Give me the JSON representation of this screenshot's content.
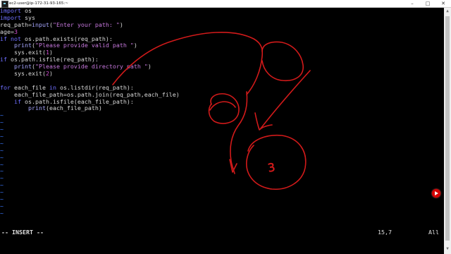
{
  "window": {
    "title": "ec2-user@ip-172-31-93-165:~",
    "minimize": "–",
    "maximize": "□",
    "close": "✕"
  },
  "editor": {
    "lines": [
      [
        {
          "t": "import",
          "c": "kw"
        },
        {
          "t": " os",
          "c": "plain"
        }
      ],
      [
        {
          "t": "import",
          "c": "kw"
        },
        {
          "t": " sys",
          "c": "plain"
        }
      ],
      [
        {
          "t": "req_path=",
          "c": "plain"
        },
        {
          "t": "input",
          "c": "fn"
        },
        {
          "t": "(",
          "c": "plain"
        },
        {
          "t": "\"Enter your path: \"",
          "c": "str"
        },
        {
          "t": ")",
          "c": "plain"
        }
      ],
      [
        {
          "t": "age=",
          "c": "plain"
        },
        {
          "t": "3",
          "c": "num"
        }
      ],
      [
        {
          "t": "if",
          "c": "kw"
        },
        {
          "t": " ",
          "c": "plain"
        },
        {
          "t": "not",
          "c": "kw"
        },
        {
          "t": " os.path.exists(req_path):",
          "c": "plain"
        }
      ],
      [
        {
          "t": "    ",
          "c": "plain"
        },
        {
          "t": "print",
          "c": "fn"
        },
        {
          "t": "(",
          "c": "plain"
        },
        {
          "t": "\"Please provide valid path \"",
          "c": "str"
        },
        {
          "t": ")",
          "c": "plain"
        }
      ],
      [
        {
          "t": "    sys.exit(",
          "c": "plain"
        },
        {
          "t": "1",
          "c": "num"
        },
        {
          "t": ")",
          "c": "plain"
        }
      ],
      [
        {
          "t": "if",
          "c": "kw"
        },
        {
          "t": " os.path.isfile(req_path):",
          "c": "plain"
        }
      ],
      [
        {
          "t": "    ",
          "c": "plain"
        },
        {
          "t": "print",
          "c": "fn"
        },
        {
          "t": "(",
          "c": "plain"
        },
        {
          "t": "\"Please provide directory path \"",
          "c": "str"
        },
        {
          "t": ")",
          "c": "plain"
        }
      ],
      [
        {
          "t": "    sys.exit(",
          "c": "plain"
        },
        {
          "t": "2",
          "c": "num"
        },
        {
          "t": ")",
          "c": "plain"
        }
      ],
      [],
      [
        {
          "t": "for",
          "c": "kw"
        },
        {
          "t": " each_file ",
          "c": "plain"
        },
        {
          "t": "in",
          "c": "kw"
        },
        {
          "t": " os.listdir(req_path):",
          "c": "plain"
        }
      ],
      [
        {
          "t": "    each_file_path=os.path.join(req_path,each_file)",
          "c": "plain"
        }
      ],
      [
        {
          "t": "    ",
          "c": "plain"
        },
        {
          "t": "if",
          "c": "kw"
        },
        {
          "t": " os.path.isfile(each_file_path):",
          "c": "plain"
        }
      ],
      [
        {
          "t": "        ",
          "c": "plain"
        },
        {
          "t": "print",
          "c": "fn"
        },
        {
          "t": "(each_file_path)",
          "c": "plain"
        }
      ]
    ],
    "empty_line_marker": "~",
    "empty_line_count": 15
  },
  "status": {
    "mode": "-- INSERT --",
    "cursor_position": "15,7",
    "scroll_position": "All"
  },
  "annotation": {
    "color": "#d11a1a",
    "circled_number": "3"
  }
}
